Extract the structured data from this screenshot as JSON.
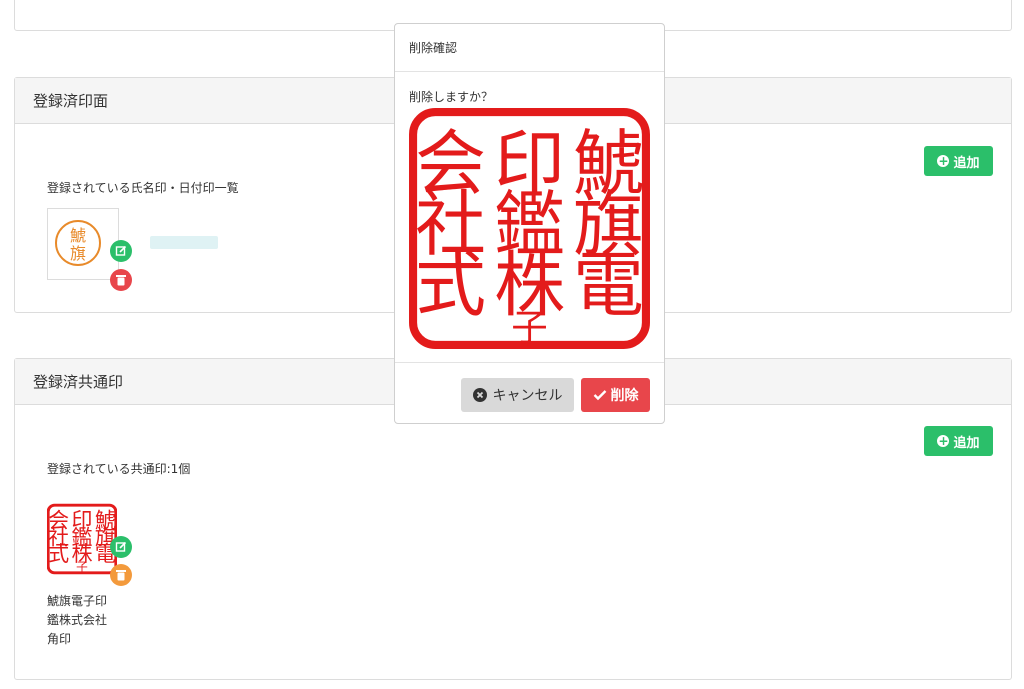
{
  "sections": {
    "personal": {
      "title": "登録済印面",
      "add_label": "追加",
      "caption": "登録されている氏名印・日付印一覧",
      "stamp_chars": [
        "鯱",
        "旗"
      ]
    },
    "common": {
      "title": "登録済共通印",
      "add_label": "追加",
      "caption": "登録されている共通印:1個",
      "stamp_lines": [
        "鯱旗電子印",
        "鑑株式会社",
        "角印"
      ]
    }
  },
  "modal": {
    "title": "削除確認",
    "message": "削除しますか？",
    "cancel_label": "キャンセル",
    "delete_label": "削除"
  },
  "colors": {
    "green": "#2bbf6a",
    "red": "#e8464b",
    "orange": "#f39a3c",
    "seal_red": "#e31b1b",
    "hanko_orange": "#e88a2a"
  },
  "icons": {
    "add": "plus-circle-icon",
    "edit": "edit-icon",
    "delete": "trash-icon",
    "cancel": "x-circle-icon",
    "confirm": "check-icon"
  }
}
